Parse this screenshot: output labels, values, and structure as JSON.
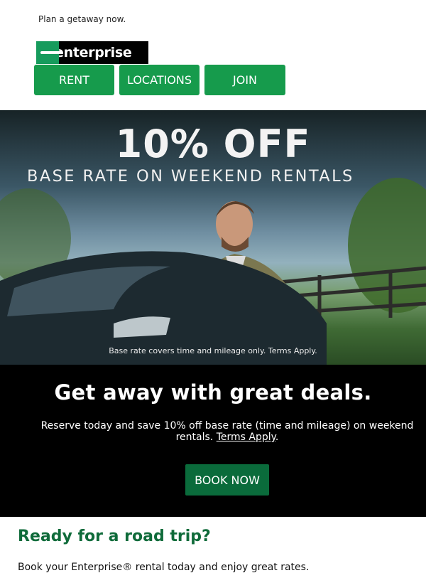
{
  "preheader": "Plan a getaway now.",
  "logo": {
    "text": "enterprise"
  },
  "nav": [
    {
      "label": "RENT"
    },
    {
      "label": "LOCATIONS"
    },
    {
      "label": "JOIN"
    }
  ],
  "hero": {
    "headline": "10% OFF",
    "subheadline": "BASE RATE ON WEEKEND RENTALS",
    "fineprint": "Base rate covers time and mileage only. Terms Apply."
  },
  "deal": {
    "title": "Get away with great deals.",
    "body": "Reserve today and save 10% off base rate (time and mileage) on weekend rentals.",
    "terms_link": "Terms Apply",
    "period": ".",
    "cta": "BOOK NOW"
  },
  "road_trip": {
    "title": "Ready for a road trip?",
    "body": "Book your Enterprise® rental today and enjoy great rates."
  },
  "colors": {
    "brand_green": "#169b4c",
    "cta_green": "#0a6b3b",
    "heading_green": "#0f6b3a"
  }
}
